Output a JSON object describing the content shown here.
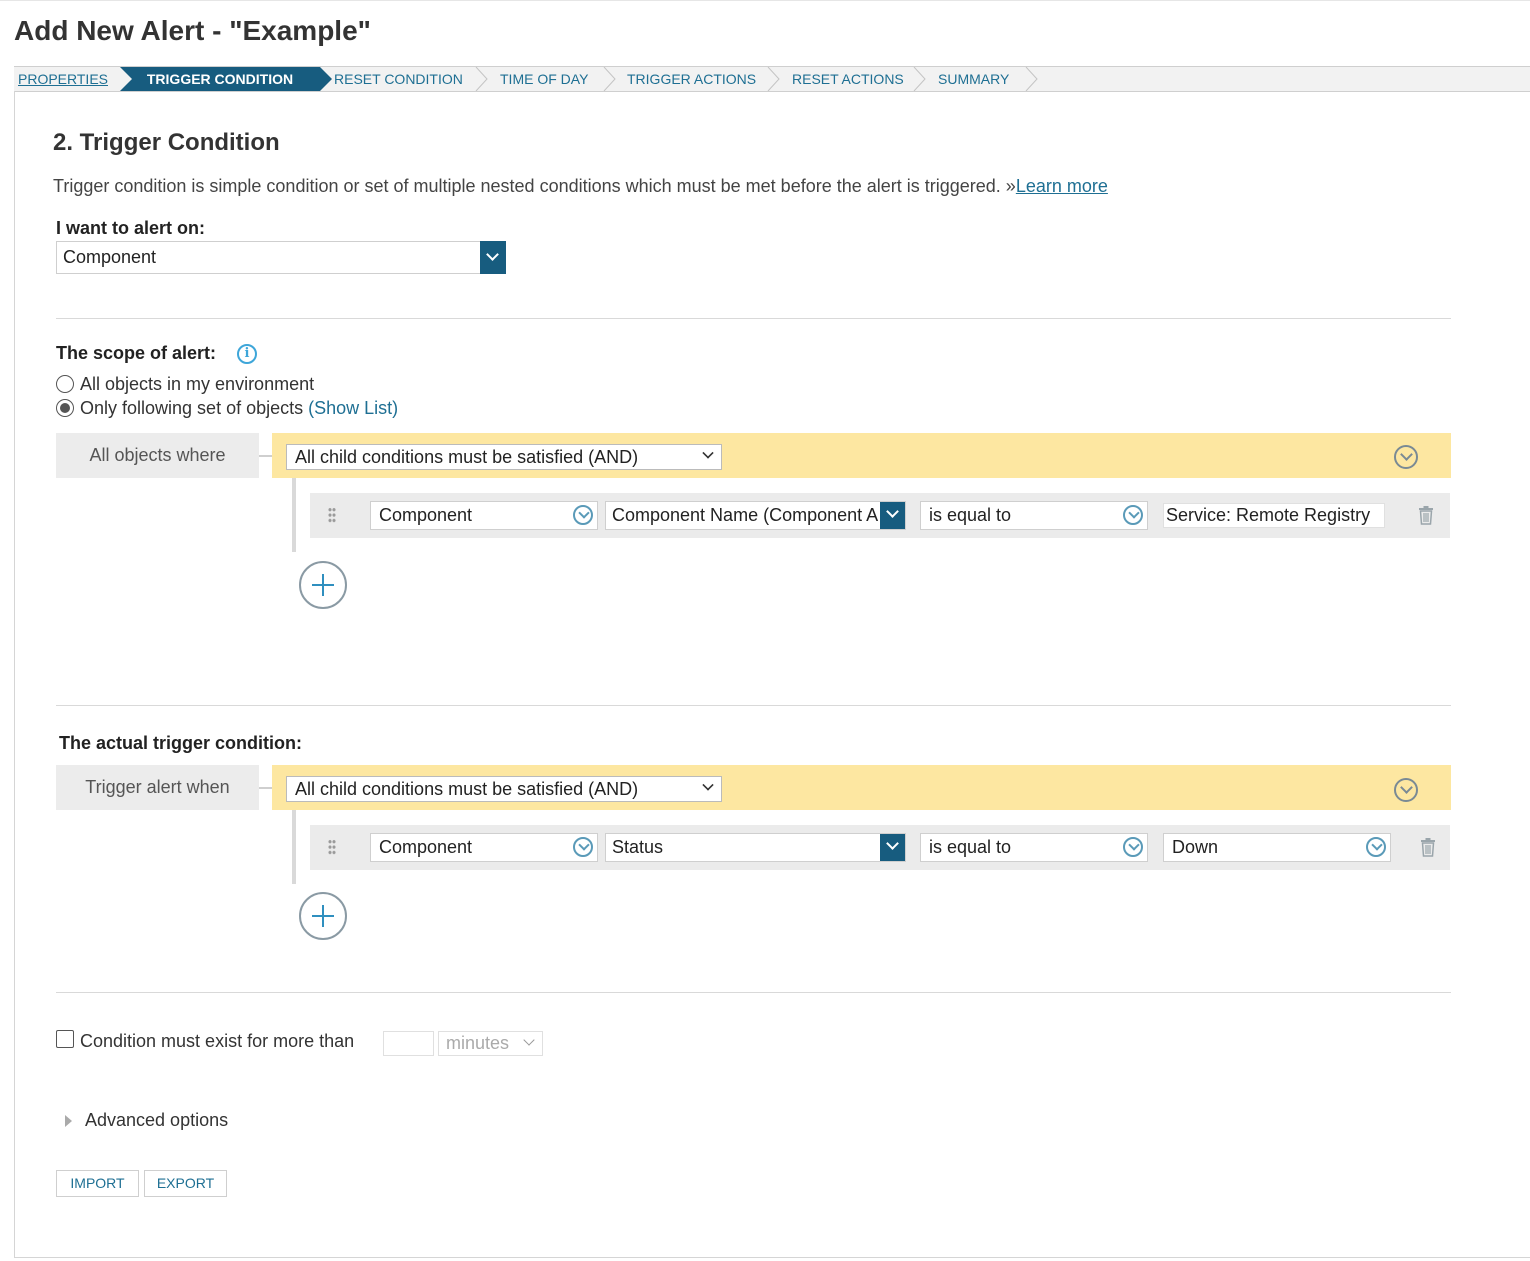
{
  "page": {
    "title": "Add New Alert - \"Example\""
  },
  "wizard": {
    "steps": [
      {
        "label": "PROPERTIES",
        "state": "done"
      },
      {
        "label": "TRIGGER CONDITION",
        "state": "active"
      },
      {
        "label": "RESET CONDITION",
        "state": "pending"
      },
      {
        "label": "TIME OF DAY",
        "state": "pending"
      },
      {
        "label": "TRIGGER ACTIONS",
        "state": "pending"
      },
      {
        "label": "RESET ACTIONS",
        "state": "pending"
      },
      {
        "label": "SUMMARY",
        "state": "pending"
      }
    ]
  },
  "section": {
    "title": "2. Trigger Condition",
    "intro": "Trigger condition is simple condition or set of multiple nested conditions which must be met before the alert is triggered. »",
    "learn_more": "Learn more"
  },
  "alert_on": {
    "label": "I want to alert on:",
    "value": "Component"
  },
  "scope": {
    "label": "The scope of alert:",
    "info_icon": "info-icon",
    "option_all": "All objects in my environment",
    "option_following": "Only following set of objects",
    "show_list": "(Show List)",
    "selected": "following",
    "where_label": "All objects where",
    "logic": "All child conditions must be satisfied (AND)",
    "condition": {
      "object": "Component",
      "field": "Component Name (Component A",
      "operator": "is equal to",
      "value": "Service: Remote Registry"
    }
  },
  "trigger": {
    "label": "The actual trigger condition:",
    "where_label": "Trigger alert when",
    "logic": "All child conditions must be satisfied (AND)",
    "condition": {
      "object": "Component",
      "field": "Status",
      "operator": "is equal to",
      "value": "Down"
    }
  },
  "duration": {
    "label": "Condition must exist for more than",
    "value": "",
    "unit": "minutes",
    "checked": false
  },
  "advanced": {
    "label": "Advanced options"
  },
  "buttons": {
    "import": "IMPORT",
    "export": "EXPORT"
  },
  "colors": {
    "accent": "#175c7f",
    "link": "#1e6f93",
    "yellow": "#fde7a1"
  }
}
